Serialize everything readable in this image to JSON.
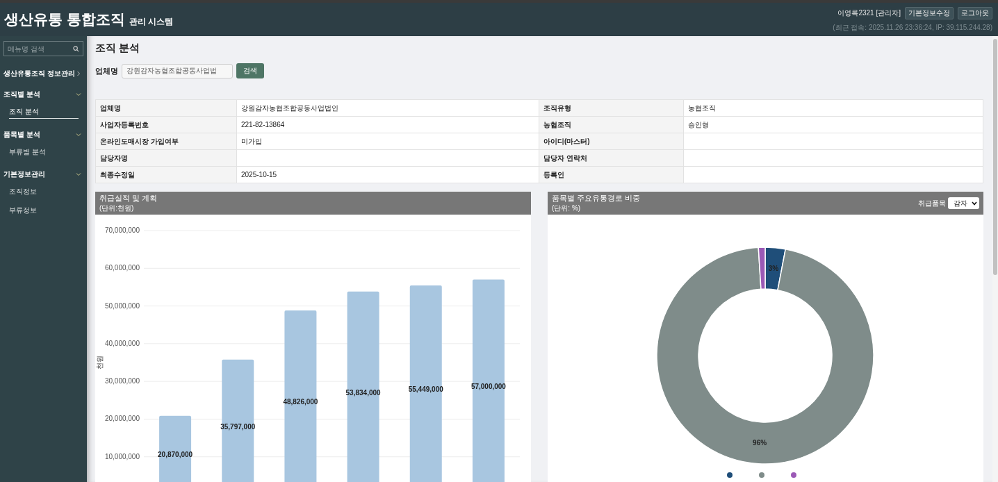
{
  "header": {
    "title": "생산유통 통합조직",
    "subtitle": "관리 시스템",
    "user": "이영록2321 [관리자]",
    "buttons": [
      "기본정보수정",
      "로그아웃"
    ],
    "last_login": "(최근 접속: 2025.11.26 23:36:24, IP: 39.115.244.28)"
  },
  "sidebar": {
    "search": {
      "placeholder": "메뉴명 검색"
    },
    "menu": [
      {
        "label": "생산유통조직 정보관리",
        "expanded": false
      },
      {
        "label": "조직별 분석",
        "expanded": true,
        "children": [
          {
            "label": "조직 분석",
            "selected": true
          }
        ]
      },
      {
        "label": "품목별 분석",
        "expanded": true,
        "children": [
          {
            "label": "부류별 분석",
            "selected": false
          }
        ]
      },
      {
        "label": "기본정보관리",
        "expanded": true,
        "children": [
          {
            "label": "조직정보",
            "selected": false
          },
          {
            "label": "부류정보",
            "selected": false
          }
        ]
      }
    ]
  },
  "page": {
    "title": "조직 분석",
    "search": {
      "label": "업체명",
      "value": "강원감자농협조합공동사업법",
      "button": "검색"
    }
  },
  "info_table": {
    "rows": [
      {
        "cells": [
          {
            "label": "업체명",
            "value": "강원감자농협조합공동사업법인"
          },
          {
            "label": "조직유형",
            "value": "농협조직"
          }
        ]
      },
      {
        "cells": [
          {
            "label": "사업자등록번호",
            "value": "221-82-13864"
          },
          {
            "label": "농협조직",
            "value": "승인형"
          }
        ]
      },
      {
        "cells": [
          {
            "label": "온라인도매시장 가입여부",
            "value": "미가입"
          },
          {
            "label": "아이디(마스터)"
          }
        ]
      },
      {
        "cells": [
          {
            "label": "담당자명"
          },
          {
            "label": "담당자 연락처"
          }
        ]
      },
      {
        "cells": [
          {
            "label": "최종수정일",
            "value": "2025-10-15"
          },
          {
            "label": "등록인"
          }
        ]
      }
    ]
  },
  "charts": [
    {
      "title": "취급실적 및 계획",
      "unit": "(단위:천원)",
      "chart_data": {
        "type": "bar",
        "grid": true,
        "ylabel": "천원",
        "ylim": [
          0,
          70000000
        ],
        "yticks": [
          {
            "value": 10000000,
            "label": "10,000,000"
          },
          {
            "value": 20000000,
            "label": "20,000,000"
          },
          {
            "value": 30000000,
            "label": "30,000,000"
          },
          {
            "value": 40000000,
            "label": "40,000,000"
          },
          {
            "value": 50000000,
            "label": "50,000,000"
          },
          {
            "value": 60000000,
            "label": "60,000,000"
          },
          {
            "value": 70000000,
            "label": "70,000,000"
          }
        ],
        "series": [
          {
            "color": "#a8c6e0",
            "values": [
              20870000,
              35797000,
              48826000,
              53834000,
              55449000,
              57000000
            ]
          }
        ],
        "value_labels": [
          "20,870,000",
          "35,797,000",
          "48,826,000",
          "53,834,000",
          "55,449,000",
          "57,000,000"
        ]
      }
    },
    {
      "title": "품목별 주요유통경로 비중",
      "unit": "(단위: %)",
      "filter": {
        "label": "취급품목",
        "value": "감자"
      },
      "chart_data": {
        "type": "donut",
        "values": [
          3,
          96,
          1
        ],
        "value_labels": [
          "3%",
          "96%",
          null
        ]
      },
      "legend": [
        {
          "color": "#1f4e79"
        },
        {
          "color": "#7f8c8a"
        },
        {
          "color": "#9b59b6"
        }
      ]
    }
  ]
}
